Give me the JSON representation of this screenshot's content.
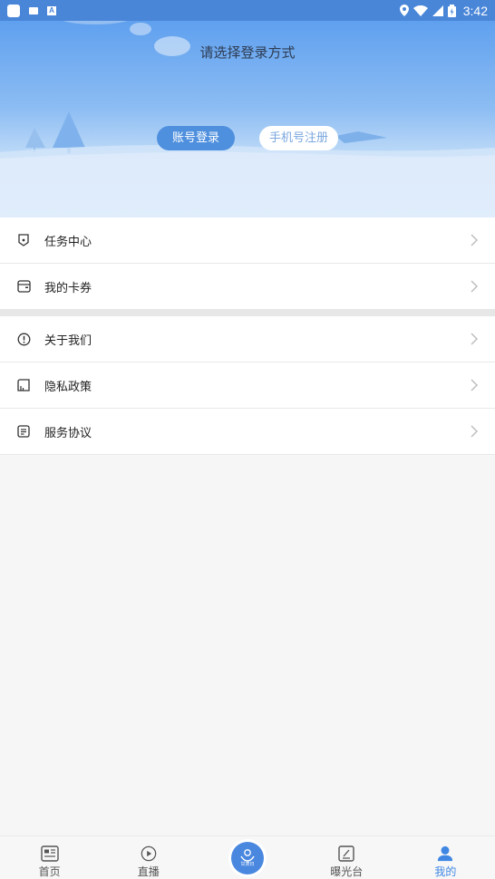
{
  "status_bar": {
    "time": "3:42"
  },
  "hero": {
    "title": "请选择登录方式",
    "account_login_label": "账号登录",
    "phone_register_label": "手机号注册"
  },
  "menu": {
    "group1": [
      {
        "label": "任务中心",
        "icon": "badge-icon"
      },
      {
        "label": "我的卡券",
        "icon": "wallet-icon"
      }
    ],
    "group2": [
      {
        "label": "关于我们",
        "icon": "info-icon"
      },
      {
        "label": "隐私政策",
        "icon": "chart-doc-icon"
      },
      {
        "label": "服务协议",
        "icon": "document-icon"
      }
    ]
  },
  "tabs": [
    {
      "label": "首页",
      "icon": "news-icon"
    },
    {
      "label": "直播",
      "icon": "play-icon"
    },
    {
      "label": "",
      "icon": "center-logo",
      "logo_text": "甘肃日"
    },
    {
      "label": "曝光台",
      "icon": "edit-icon"
    },
    {
      "label": "我的",
      "icon": "user-icon",
      "active": true
    }
  ],
  "colors": {
    "accent": "#4a86d8",
    "active_tab": "#3f87e3"
  }
}
